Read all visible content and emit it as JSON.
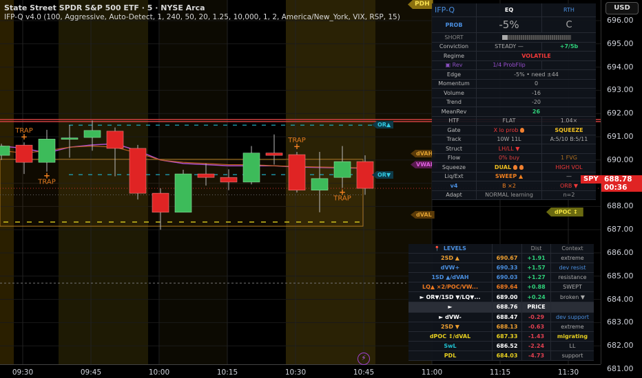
{
  "header": {
    "title": "State Street SPDR S&P 500 ETF · 5 · NYSE Arca",
    "indicator": "IFP-Q v4.0 (100, Aggressive, Auto-Detect, 1, 240, 50, 20, 1.25, 10,000, 1, 2, America/New_York, VIX, RSP, 15)"
  },
  "currency": "USD",
  "symbol": "SPY",
  "last_price": "688.78",
  "countdown": "00:36",
  "price_axis": [
    "696.00",
    "695.00",
    "694.00",
    "693.00",
    "692.00",
    "691.00",
    "690.00",
    "689.00",
    "688.00",
    "687.00",
    "686.00",
    "685.00",
    "684.00",
    "683.00",
    "682.00",
    "681.00"
  ],
  "time_axis": [
    "09:30",
    "09:45",
    "10:00",
    "10:15",
    "10:30",
    "10:45",
    "11:00",
    "11:15",
    "11:30"
  ],
  "tags": {
    "pdh": "PDH",
    "or_high": "OR▲",
    "or_low": "OR▼",
    "dvah": "dVAH",
    "vwap": "VWAP",
    "dval": "dVAL",
    "dpoc": "dPOC ↕"
  },
  "traps": [
    "TRAP",
    "TRAP",
    "TRAP",
    "TRAP"
  ],
  "dashboard": {
    "short_fill_pct": 5,
    "rows": [
      [
        {
          "t": "IFP-Q",
          "c": "#4a8fe0",
          "s": 11
        },
        {
          "t": "EQ",
          "c": "#ffffff",
          "b": 1
        },
        {
          "t": "RTH",
          "c": "#4a8fe0"
        }
      ],
      [
        {
          "t": "PROB",
          "c": "#4a8fe0",
          "b": 1
        },
        {
          "t": "-5%",
          "c": "#aaaaaa",
          "s": 15
        },
        {
          "t": "C",
          "c": "#aaaaaa",
          "s": 13
        }
      ],
      [
        {
          "t": "SHORT",
          "c": "#888888"
        },
        {
          "bar": 1
        }
      ],
      [
        {
          "t": "Conviction",
          "c": "#bbbbbb"
        },
        {
          "t": "STEADY —",
          "c": "#aaaaaa"
        },
        {
          "t": "+7/5b",
          "c": "#2fd07a",
          "b": 1
        }
      ],
      [
        {
          "t": "Regime",
          "c": "#bbbbbb"
        },
        {
          "t": "VOLATILE",
          "c": "#f03838",
          "b": 1,
          "span": 1
        }
      ],
      [
        {
          "t": "▣ Rev",
          "c": "#8a4fc0"
        },
        {
          "t": "1/4 ProbFlip",
          "c": "#9a4fd0"
        },
        {
          "t": ""
        }
      ],
      [
        {
          "t": "Edge",
          "c": "#bbbbbb"
        },
        {
          "t": "-5% • need ±44",
          "c": "#aaaaaa",
          "span": 1
        }
      ],
      [
        {
          "t": "Momentum",
          "c": "#bbbbbb"
        },
        {
          "t": "0",
          "c": "#aaaaaa",
          "span": 1
        }
      ],
      [
        {
          "t": "Volume",
          "c": "#bbbbbb"
        },
        {
          "t": "-16",
          "c": "#aaaaaa",
          "span": 1
        }
      ],
      [
        {
          "t": "Trend",
          "c": "#bbbbbb"
        },
        {
          "t": "-20",
          "c": "#aaaaaa",
          "span": 1
        }
      ],
      [
        {
          "t": "MeanRev",
          "c": "#bbbbbb"
        },
        {
          "t": "26",
          "c": "#2fd07a",
          "b": 1,
          "span": 1
        }
      ],
      [
        {
          "t": "HTF",
          "c": "#bbbbbb"
        },
        {
          "t": "FLAT",
          "c": "#aaaaaa"
        },
        {
          "t": "1.04×",
          "c": "#aaaaaa"
        }
      ],
      [
        {
          "t": "Gate",
          "c": "#bbbbbb"
        },
        {
          "t": "X lo prob",
          "c": "#f03838",
          "f": 1
        },
        {
          "t": "SQUEEZE",
          "c": "#f0c020",
          "b": 1
        }
      ],
      [
        {
          "t": "Track",
          "c": "#bbbbbb"
        },
        {
          "t": "10W 11L",
          "c": "#aaaaaa"
        },
        {
          "t": "A:5/10 B:5/11",
          "c": "#aaaaaa"
        }
      ],
      [
        {
          "t": "Struct",
          "c": "#bbbbbb"
        },
        {
          "t": "LH/LL ▼",
          "c": "#f03838"
        },
        {
          "t": ""
        }
      ],
      [
        {
          "t": "Flow",
          "c": "#bbbbbb"
        },
        {
          "t": "0% buy",
          "c": "#e04040"
        },
        {
          "t": "1 FVG",
          "c": "#b07020"
        }
      ],
      [
        {
          "t": "Squeeze",
          "c": "#bbbbbb"
        },
        {
          "t": "DUAL",
          "c": "#f0c020",
          "b": 1,
          "f": 2
        },
        {
          "t": "HIGH VOL",
          "c": "#f03838"
        }
      ],
      [
        {
          "t": "Liq/Ext",
          "c": "#bbbbbb"
        },
        {
          "t": "SWEEP ▲",
          "c": "#f08020",
          "b": 1
        },
        {
          "t": "—",
          "c": "#aaaaaa"
        }
      ],
      [
        {
          "t": "v4",
          "c": "#4a8fe0",
          "b": 1
        },
        {
          "t": "B ×2",
          "c": "#f08020"
        },
        {
          "t": "ORB ▼",
          "c": "#f03838"
        }
      ],
      [
        {
          "t": "Adapt",
          "c": "#bbbbbb"
        },
        {
          "t": "NORMAL learning",
          "c": "#999999"
        },
        {
          "t": "n=2",
          "c": "#999999"
        }
      ]
    ]
  },
  "levels": {
    "header": {
      "title": "LEVELS",
      "dist": "Dist",
      "context": "Context"
    },
    "rows": [
      {
        "name": "2SD ▲",
        "nc": "#f0a030",
        "value": "690.67",
        "vc": "#f0a030",
        "dist": "+1.91",
        "dc": "#2fd07a",
        "ctx": "extreme",
        "cc": "#aaaaaa"
      },
      {
        "name": "dVW+",
        "nc": "#4a8fe0",
        "value": "690.33",
        "vc": "#4a8fe0",
        "dist": "+1.57",
        "dc": "#2fd07a",
        "ctx": "dev resist",
        "cc": "#4a8fe0"
      },
      {
        "name": "1SD ▲/dVAH",
        "nc": "#4a8fe0",
        "value": "690.03",
        "vc": "#4a8fe0",
        "dist": "+1.27",
        "dc": "#2fd07a",
        "ctx": "resistance",
        "cc": "#aaaaaa"
      },
      {
        "name": "LQ▲ ×2/POC/VW...",
        "nc": "#f07a20",
        "value": "689.64",
        "vc": "#f07a20",
        "dist": "+0.88",
        "dc": "#2fd07a",
        "ctx": "SWEPT",
        "cc": "#aaaaaa"
      },
      {
        "name": "► OR▼/1SD ▼/LQ▼...",
        "nc": "#ffffff",
        "value": "689.00",
        "vc": "#ffffff",
        "dist": "+0.24",
        "dc": "#2fd07a",
        "ctx": "broken ▼",
        "cc": "#aaaaaa"
      },
      {
        "name": "►",
        "nc": "#ffffff",
        "value": "688.76",
        "vc": "#ffffff",
        "dist": "PRICE",
        "dc": "#ffffff",
        "ctx": "",
        "cc": "#aaaaaa",
        "price": true
      },
      {
        "name": "► dVW-",
        "nc": "#ffffff",
        "value": "688.47",
        "vc": "#ffffff",
        "dist": "-0.29",
        "dc": "#e04050",
        "ctx": "dev support",
        "cc": "#4a8fe0"
      },
      {
        "name": "2SD ▼",
        "nc": "#f0a030",
        "value": "688.13",
        "vc": "#f0a030",
        "dist": "-0.63",
        "dc": "#e04050",
        "ctx": "extreme",
        "cc": "#aaaaaa"
      },
      {
        "name": "dPOC ↕/dVAL",
        "nc": "#e8d020",
        "value": "687.33",
        "vc": "#e8d020",
        "dist": "-1.43",
        "dc": "#e04050",
        "ctx": "migrating",
        "cc": "#e8d020"
      },
      {
        "name": "SwL",
        "nc": "#20c0d0",
        "value": "686.52",
        "vc": "#ffffff",
        "dist": "-2.24",
        "dc": "#e04050",
        "ctx": "LL",
        "cc": "#aaaaaa"
      },
      {
        "name": "PDL",
        "nc": "#e8d020",
        "value": "684.03",
        "vc": "#e8d020",
        "dist": "-4.73",
        "dc": "#e04050",
        "ctx": "support",
        "cc": "#aaaaaa"
      }
    ]
  },
  "colors": {
    "up": "#3dbb5a",
    "down": "#e02424",
    "vwap": "#b050d0",
    "or": "#1fa8c0",
    "box": "#b07a20",
    "accent": "#4a8fe0"
  },
  "chart_data": {
    "type": "candlestick",
    "ylim": [
      681,
      696
    ],
    "candles": [
      [
        690.2,
        690.7,
        690.0,
        690.6
      ],
      [
        690.64,
        690.76,
        689.4,
        689.9
      ],
      [
        689.9,
        691.3,
        689.5,
        690.9
      ],
      [
        690.9,
        691.5,
        690.1,
        690.95
      ],
      [
        690.97,
        691.7,
        690.4,
        691.27
      ],
      [
        691.24,
        691.4,
        689.3,
        690.5
      ],
      [
        690.5,
        690.65,
        688.3,
        688.57
      ],
      [
        688.57,
        688.78,
        687.0,
        687.75
      ],
      [
        687.75,
        689.58,
        687.75,
        689.4
      ],
      [
        689.4,
        689.85,
        688.9,
        689.25
      ],
      [
        689.25,
        689.6,
        688.7,
        689.05
      ],
      [
        689.05,
        690.6,
        688.95,
        690.3
      ],
      [
        690.3,
        691.1,
        689.8,
        690.2
      ],
      [
        690.23,
        690.35,
        688.6,
        688.7
      ],
      [
        688.7,
        690.35,
        687.75,
        689.2
      ],
      [
        689.25,
        690.6,
        688.8,
        689.93
      ],
      [
        689.93,
        690.2,
        688.5,
        688.78
      ]
    ],
    "vwap": [
      690.6,
      690.5,
      690.3,
      690.55,
      690.65,
      690.7,
      690.4,
      690.0,
      689.85,
      689.8,
      689.75,
      689.75,
      689.75,
      689.7,
      689.68,
      689.66,
      689.65
    ],
    "orange_line": [
      690.4,
      690.3,
      690.4,
      690.55,
      690.6,
      690.55,
      690.3,
      690.0,
      689.9,
      689.85,
      689.8,
      689.8,
      689.75,
      689.72,
      689.7,
      689.68,
      689.66
    ],
    "levels": {
      "resistance": 691.7,
      "or_high": 691.5,
      "or_low": 689.37,
      "dvah": 690.03,
      "dval": 687.15,
      "dval_dash": 687.33,
      "price": 688.78,
      "gray_dotted": 688.5,
      "lower_dashed": 684.7
    },
    "trap_candles": [
      {
        "i": 1,
        "pos": "above"
      },
      {
        "i": 2,
        "pos": "below"
      },
      {
        "i": 13,
        "pos": "above"
      },
      {
        "i": 15,
        "pos": "below"
      }
    ]
  }
}
